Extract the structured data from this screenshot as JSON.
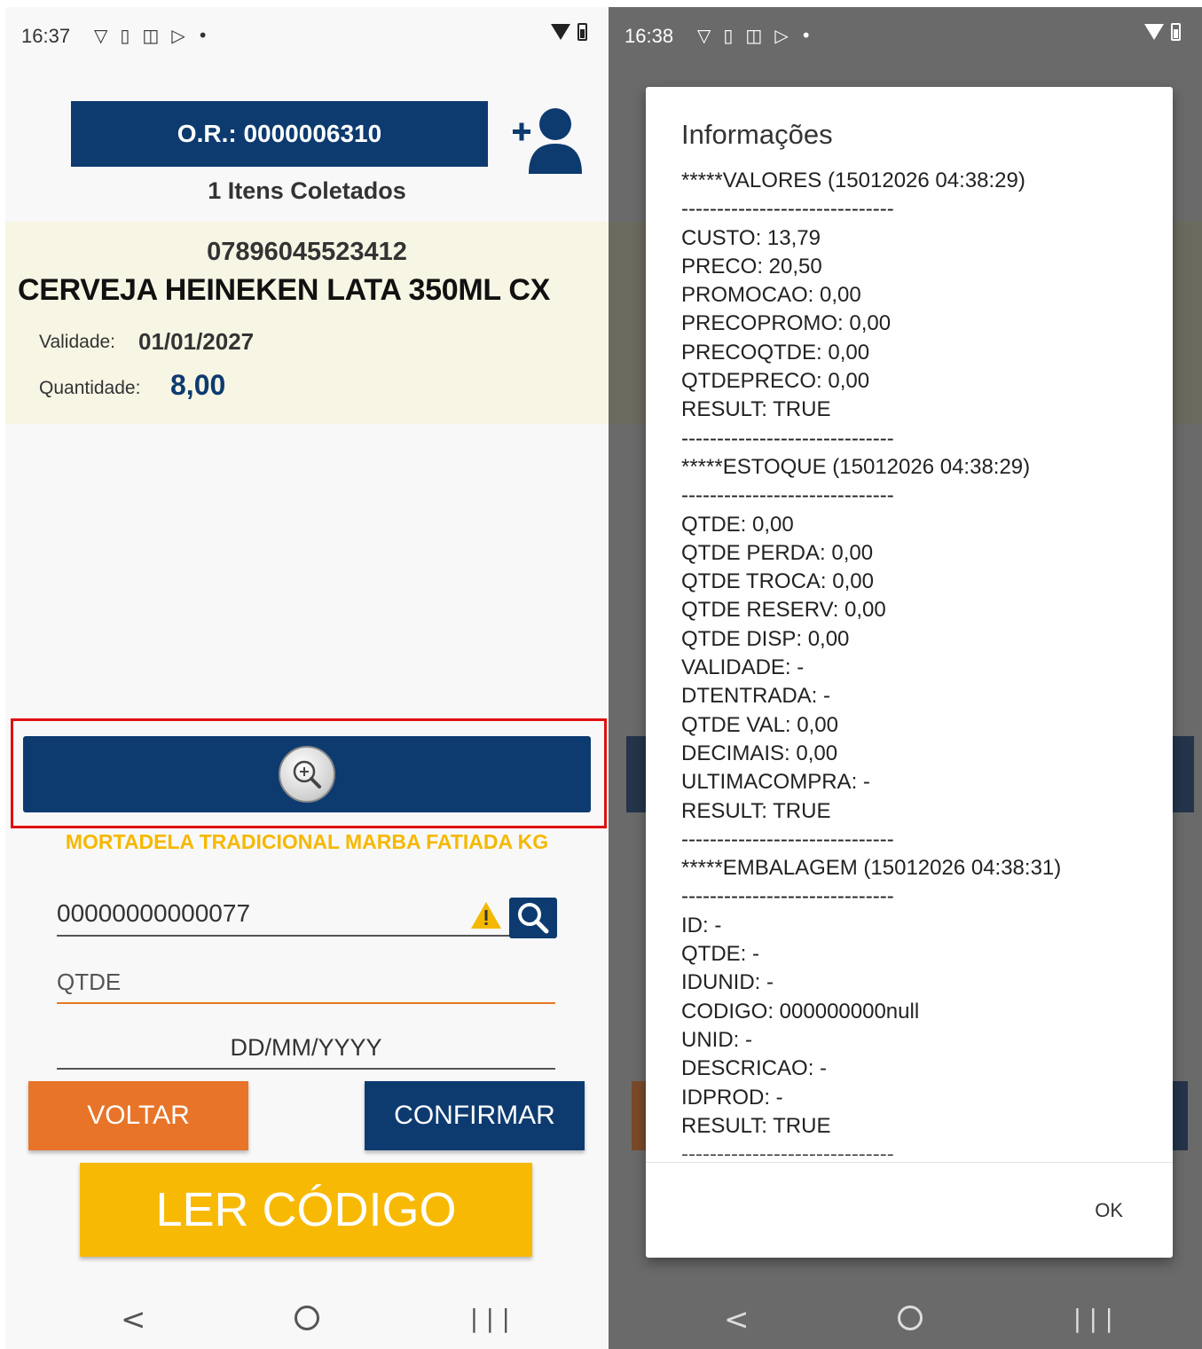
{
  "left": {
    "status": {
      "time": "16:37"
    },
    "or_label": "O.R.: 0000006310",
    "items_count": "1 Itens Coletados",
    "product": {
      "barcode": "07896045523412",
      "name": "CERVEJA HEINEKEN LATA 350ML CX",
      "validade_label": "Validade:",
      "validade_value": "01/01/2027",
      "quantidade_label": "Quantidade:",
      "quantidade_value": "8,00"
    },
    "second_product": "MORTADELA TRADICIONAL MARBA FATIADA KG",
    "code_input_value": "00000000000077",
    "qtde_placeholder": "QTDE",
    "date_placeholder": "DD/MM/YYYY",
    "voltar_label": "VOLTAR",
    "confirmar_label": "CONFIRMAR",
    "ler_label": "LER CÓDIGO"
  },
  "right": {
    "status": {
      "time": "16:38"
    },
    "dialog": {
      "title": "Informações",
      "lines": [
        "*****VALORES (15012026 04:38:29)",
        "------------------------------",
        "CUSTO: 13,79",
        "PRECO: 20,50",
        "PROMOCAO: 0,00",
        "PRECOPROMO: 0,00",
        "PRECOQTDE: 0,00",
        "QTDEPRECO: 0,00",
        "RESULT: TRUE",
        "------------------------------",
        "*****ESTOQUE (15012026 04:38:29)",
        "------------------------------",
        "QTDE: 0,00",
        "QTDE PERDA: 0,00",
        "QTDE TROCA: 0,00",
        "QTDE RESERV: 0,00",
        "QTDE DISP: 0,00",
        "VALIDADE: -",
        "DTENTRADA: -",
        "QTDE VAL: 0,00",
        "DECIMAIS: 0,00",
        "ULTIMACOMPRA: -",
        "RESULT: TRUE",
        "------------------------------",
        "*****EMBALAGEM (15012026 04:38:31)",
        "------------------------------",
        "ID: -",
        "QTDE: -",
        "IDUNID: -",
        "CODIGO: 000000000null",
        "UNID: -",
        "DESCRICAO: -",
        "IDPROD: -",
        "RESULT: TRUE",
        "------------------------------"
      ],
      "ok_label": "OK"
    }
  },
  "icons": [
    "shield-icon",
    "device-icon",
    "bag-icon",
    "play-store-icon",
    "wifi-icon",
    "battery-icon",
    "add-user-icon",
    "zoom-in-icon",
    "warning-icon",
    "search-icon",
    "nav-back-icon",
    "nav-home-icon",
    "nav-recent-icon"
  ],
  "colors": {
    "navy": "#0d3b70",
    "orange": "#e77428",
    "yellow": "#f8b904",
    "highlight_red": "#e01010",
    "card_bg": "#f7f5e4"
  }
}
